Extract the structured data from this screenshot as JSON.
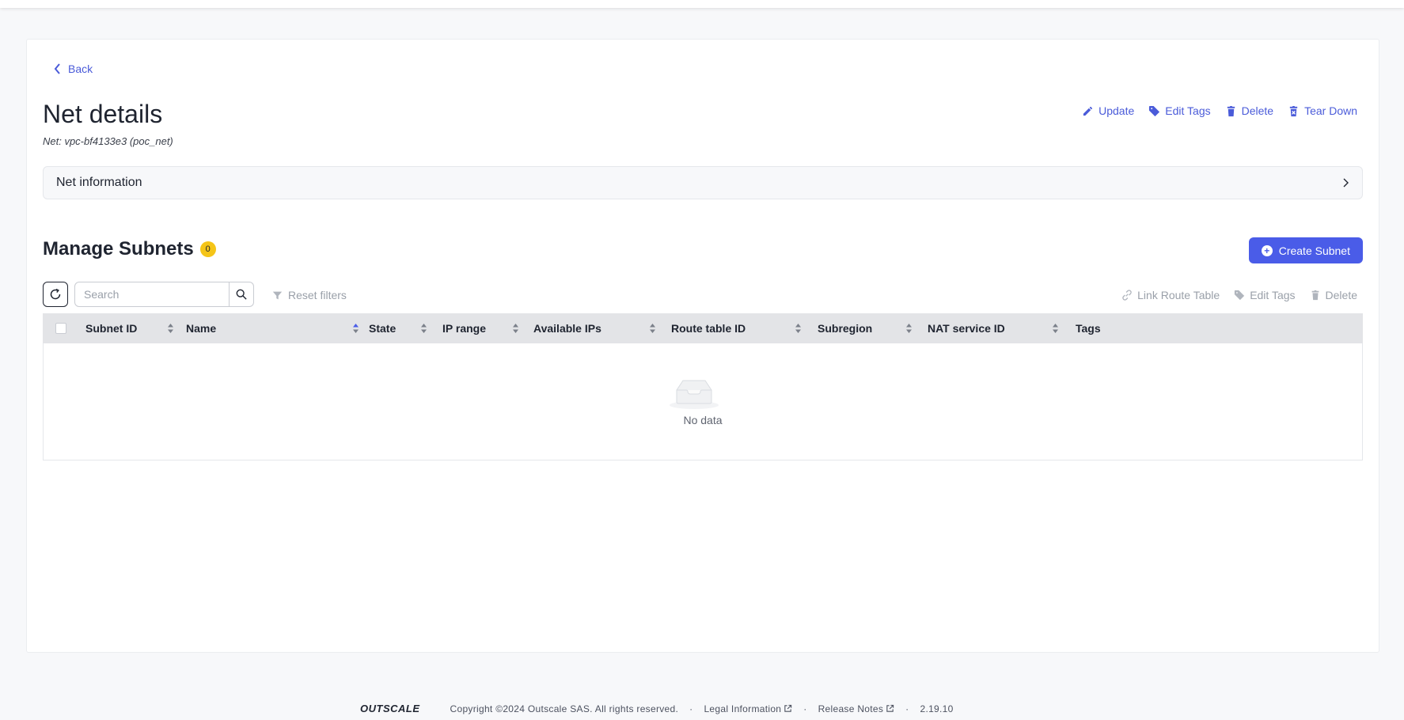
{
  "nav": {
    "back_label": "Back"
  },
  "header": {
    "title": "Net details",
    "subtitle": "Net: vpc-bf4133e3 (poc_net)",
    "actions": {
      "update": "Update",
      "edit_tags": "Edit Tags",
      "delete": "Delete",
      "tear_down": "Tear Down"
    }
  },
  "net_info": {
    "label": "Net information"
  },
  "subnets": {
    "title": "Manage Subnets",
    "count": "0",
    "create_label": "Create Subnet",
    "search_placeholder": "Search",
    "reset_filters": "Reset filters",
    "table_actions": {
      "link_route_table": "Link Route Table",
      "edit_tags": "Edit Tags",
      "delete": "Delete"
    },
    "columns": [
      "Subnet ID",
      "Name",
      "State",
      "IP range",
      "Available IPs",
      "Route table ID",
      "Subregion",
      "NAT service ID",
      "Tags"
    ],
    "sort_active_column": "Name",
    "empty_text": "No data"
  },
  "footer": {
    "brand": "OUTSCALE",
    "copyright": "Copyright ©2024 Outscale SAS. All rights reserved.",
    "legal": "Legal Information",
    "release_notes": "Release Notes",
    "version": "2.19.10"
  },
  "colors": {
    "accent": "#4a5ce8",
    "link": "#4a5bd9",
    "badge": "#f5c518",
    "header_bg": "#e3e4e7"
  }
}
